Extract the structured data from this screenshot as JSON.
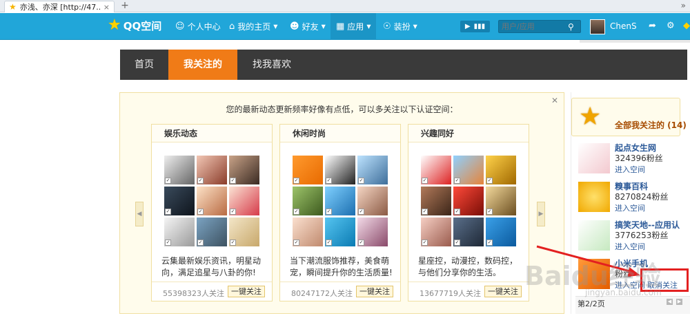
{
  "browser": {
    "tab_title": "亦浅、亦深 [http://47...",
    "tab_close": "×",
    "new_tab": "+",
    "more": "»"
  },
  "topnav": {
    "logo_text": "QQ空间",
    "items": [
      {
        "label": "个人中心",
        "icon": "person-icon"
      },
      {
        "label": "我的主页",
        "icon": "home-icon"
      },
      {
        "label": "好友",
        "icon": "friends-icon"
      },
      {
        "label": "应用",
        "icon": "apps-grid-icon"
      },
      {
        "label": "装扮",
        "icon": "shirt-icon"
      }
    ],
    "search_placeholder": "用户/应用",
    "username": "ChenS"
  },
  "page_tabs": [
    "首页",
    "我关注的",
    "找我喜欢"
  ],
  "notice": "您的最新动态更新频率好像有点低，可以多关注以下认证空间：",
  "cards": [
    {
      "title": "娱乐动态",
      "desc": "云集最新娱乐资讯，明星动向，满足追星与八卦的你!",
      "fans": "55398323人关注",
      "follow": "一键关注"
    },
    {
      "title": "休闲时尚",
      "desc": "当下潮流服饰推荐，美食萌宠，瞬间提升你的生活质量!",
      "fans": "80247172人关注",
      "follow": "一键关注"
    },
    {
      "title": "兴趣同好",
      "desc": "星座控，动漫控，数码控，与他们分享你的生活。",
      "fans": "13677719人关注",
      "follow": "一键关注"
    }
  ],
  "side": {
    "header": "全部我关注的 (14)",
    "items": [
      {
        "name": "起点女生网",
        "fans": "324396粉丝",
        "enter": "进入空间"
      },
      {
        "name": "糗事百科",
        "fans": "8270824粉丝",
        "enter": "进入空间"
      },
      {
        "name": "搞笑天地--应用认",
        "fans": "3776253粉丝",
        "enter": "进入空间"
      },
      {
        "name": "小米手机",
        "fans": "粉丝",
        "enter": "进入空间",
        "unfollow": "取消关注"
      }
    ],
    "page": "第2/2页"
  },
  "watermark": "Baidu经验",
  "watermark_url": "jingyan.baidu.com",
  "colors": {
    "nav": "#21a6d9",
    "active_tab": "#f07b17",
    "highlight": "#e32020"
  }
}
